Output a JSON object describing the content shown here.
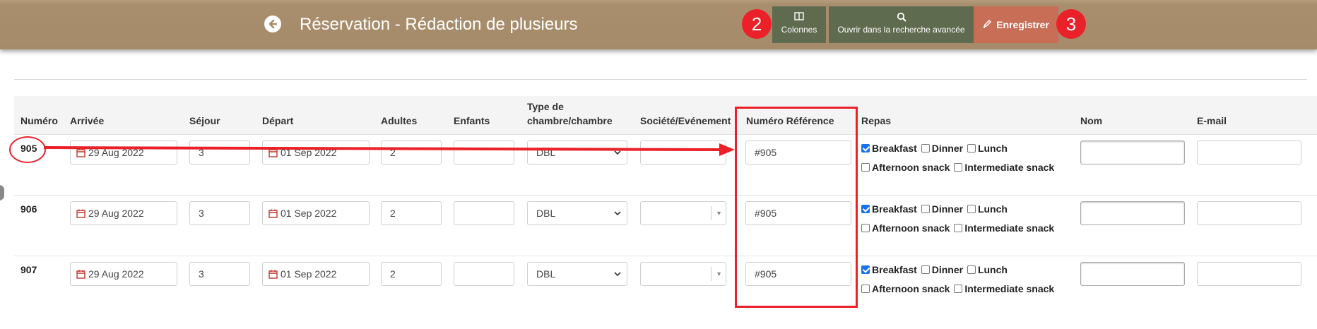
{
  "header": {
    "title": "Réservation - Rédaction de plusieurs",
    "columns_label": "Colonnes",
    "advanced_search_label": "Ouvrir dans la recherche avancée",
    "save_label": "Enregistrer"
  },
  "annotations": {
    "badge_2": "2",
    "badge_3": "3",
    "highlight_color": "#ea2128"
  },
  "table": {
    "headers": {
      "numero": "Numéro",
      "arrivee": "Arrivée",
      "sejour": "Séjour",
      "depart": "Départ",
      "adultes": "Adultes",
      "enfants": "Enfants",
      "type_line1": "Type de",
      "type_line2": "chambre/chambre",
      "societe": "Société/Evénement",
      "reference": "Numéro Référence",
      "repas": "Repas",
      "nom": "Nom",
      "email": "E-mail"
    },
    "rows": [
      {
        "numero": "905",
        "arrivee": "29 Aug 2022",
        "sejour": "3",
        "depart": "01 Sep 2022",
        "adultes": "2",
        "enfants": "",
        "type": "DBL",
        "societe": "",
        "reference": "#905",
        "meals": {
          "breakfast": "Breakfast",
          "dinner": "Dinner",
          "lunch": "Lunch",
          "afternoon": "Afternoon snack",
          "intermediate": "Intermediate snack"
        },
        "nom": "",
        "email": ""
      },
      {
        "numero": "906",
        "arrivee": "29 Aug 2022",
        "sejour": "3",
        "depart": "01 Sep 2022",
        "adultes": "2",
        "enfants": "",
        "type": "DBL",
        "societe": "",
        "reference": "#905",
        "meals": {
          "breakfast": "Breakfast",
          "dinner": "Dinner",
          "lunch": "Lunch",
          "afternoon": "Afternoon snack",
          "intermediate": "Intermediate snack"
        },
        "nom": "",
        "email": ""
      },
      {
        "numero": "907",
        "arrivee": "29 Aug 2022",
        "sejour": "3",
        "depart": "01 Sep 2022",
        "adultes": "2",
        "enfants": "",
        "type": "DBL",
        "societe": "",
        "reference": "#905",
        "meals": {
          "breakfast": "Breakfast",
          "dinner": "Dinner",
          "lunch": "Lunch",
          "afternoon": "Afternoon snack",
          "intermediate": "Intermediate snack"
        },
        "nom": "",
        "email": ""
      }
    ]
  },
  "colors": {
    "topbar": "#a58b69",
    "button": "#5f6b4f",
    "save_button": "#c86e57",
    "checkbox_checked": "#1a73e8"
  }
}
